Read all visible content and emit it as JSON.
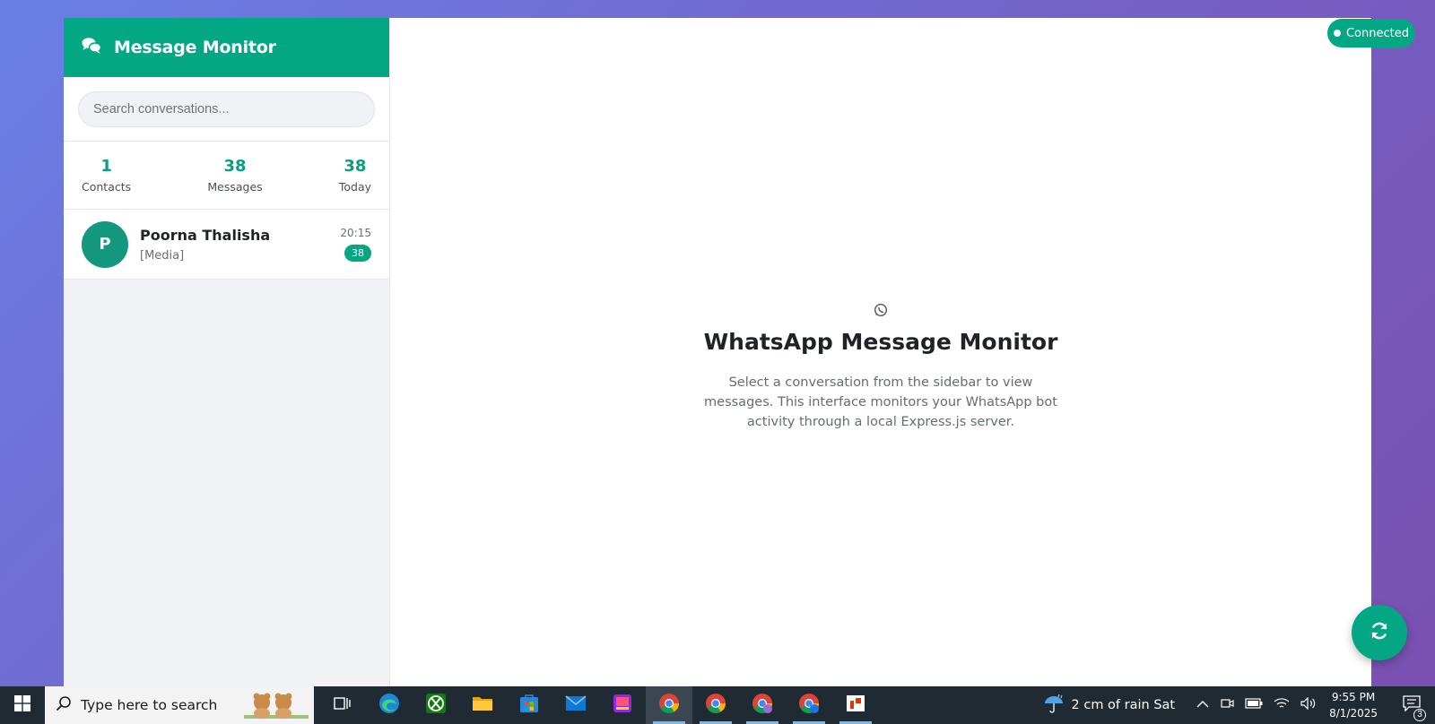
{
  "sidebar": {
    "title": "Message Monitor",
    "search_placeholder": "Search conversations...",
    "stats": [
      {
        "value": "1",
        "label": "Contacts"
      },
      {
        "value": "38",
        "label": "Messages"
      },
      {
        "value": "38",
        "label": "Today"
      }
    ],
    "conversations": [
      {
        "initial": "P",
        "name": "Poorna Thalisha",
        "preview": "[Media]",
        "time": "20:15",
        "unread": "38"
      }
    ]
  },
  "main": {
    "title": "WhatsApp Message Monitor",
    "description": "Select a conversation from the sidebar to view messages. This interface monitors your WhatsApp bot activity through a local Express.js server."
  },
  "status": {
    "label": "Connected"
  },
  "taskbar": {
    "search_text": "Type here to search",
    "apps": [
      "task-view",
      "edge",
      "xbox",
      "file-explorer",
      "microsoft-store",
      "mail",
      "paint-app",
      "chrome",
      "chrome",
      "chrome",
      "chrome",
      "office"
    ],
    "weather": "2 cm of rain Sat",
    "time": "9:55 PM",
    "date": "8/1/2025",
    "notification_count": "3"
  },
  "colors": {
    "accent": "#04a784",
    "accent_dark": "#13977e"
  }
}
